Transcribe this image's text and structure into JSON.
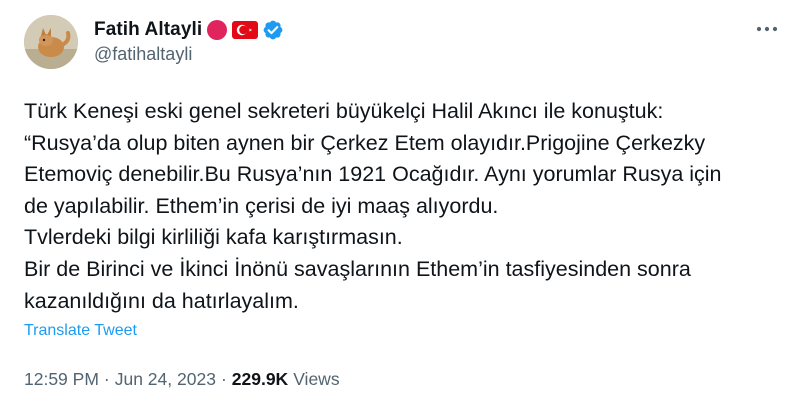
{
  "author": {
    "display_name": "Fatih Altayli",
    "handle": "@fatihaltayli",
    "badges": [
      "red-circle-icon",
      "turkey-flag-icon",
      "verified-badge-icon"
    ]
  },
  "tweet": {
    "lines": [
      "Türk Keneşi eski genel sekreteri büyükelçi Halil Akıncı ile konuştuk:",
      "“Rusya’da olup biten aynen bir Çerkez Etem olayıdır.Prigojine Çerkezky",
      "Etemoviç denebilir.Bu Rusya’nın 1921 Ocağıdır. Aynı yorumlar Rusya için",
      "de yapılabilir. Ethem’in çerisi de iyi maaş alıyordu.",
      "Tvlerdeki bilgi kirliliği kafa karıştırmasın.",
      "Bir de Birinci ve İkinci İnönü savaşlarının Ethem’in tasfiyesinden sonra",
      "kazanıldığını da hatırlayalım."
    ],
    "translate_label": "Translate Tweet"
  },
  "meta": {
    "time": "12:59 PM",
    "separator": "·",
    "date": "Jun 24, 2023",
    "views_count": "229.9K",
    "views_label": "Views"
  },
  "colors": {
    "text": "#0f1419",
    "secondary": "#536471",
    "link": "#1d9bf0",
    "verified": "#1d9bf0",
    "red_circle": "#e0245e",
    "flag_red": "#e30a17"
  }
}
